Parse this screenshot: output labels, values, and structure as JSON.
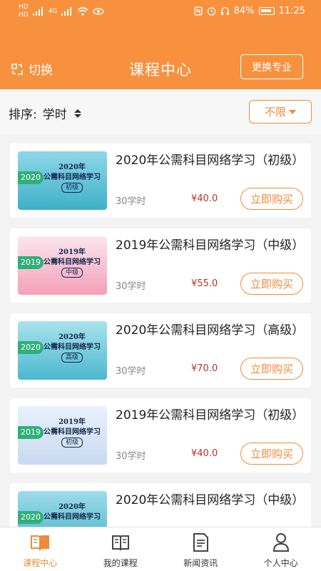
{
  "status_bar": {
    "left_labels": [
      "HD",
      "4G",
      "HD",
      "4G"
    ],
    "battery": "84%",
    "time": "11:25"
  },
  "header": {
    "switch_label": "切换",
    "title": "课程中心",
    "change_major_label": "更换专业"
  },
  "sort": {
    "label": "排序:",
    "value": "学时",
    "filter_label": "不限"
  },
  "courses": [
    {
      "title": "2020年公需科目网络学习（初级）",
      "hours": "30学时",
      "price": "¥40.0",
      "buy_label": "立即购买",
      "thumb": {
        "year": "2020",
        "line1": "2020年",
        "line2": "公需科目网络学习",
        "level": "初级",
        "bg1": "#8ed7e8",
        "bg2": "#3fb0c8"
      }
    },
    {
      "title": "2019年公需科目网络学习（中级）",
      "hours": "30学时",
      "price": "¥55.0",
      "buy_label": "立即购买",
      "thumb": {
        "year": "2019",
        "line1": "2019年",
        "line2": "公需科目网络学习",
        "level": "中级",
        "bg1": "#fbe6ef",
        "bg2": "#f3a0b8"
      }
    },
    {
      "title": "2020年公需科目网络学习（高级）",
      "hours": "30学时",
      "price": "¥70.0",
      "buy_label": "立即购买",
      "thumb": {
        "year": "2020",
        "line1": "2020年",
        "line2": "公需科目网络学习",
        "level": "高级",
        "bg1": "#a9e3ee",
        "bg2": "#4cb8cf"
      }
    },
    {
      "title": "2019年公需科目网络学习（初级）",
      "hours": "30学时",
      "price": "¥40.0",
      "buy_label": "立即购买",
      "thumb": {
        "year": "2019",
        "line1": "2019年",
        "line2": "公需科目网络学习",
        "level": "初级",
        "bg1": "#e9f1fb",
        "bg2": "#c9d9ef"
      }
    },
    {
      "title": "2020年公需科目网络学习（中级）",
      "hours": "",
      "price": "",
      "buy_label": "",
      "thumb": {
        "year": "2020",
        "line1": "2020年",
        "line2": "公需科目网络学习",
        "level": "",
        "bg1": "#9edcea",
        "bg2": "#48b4cb"
      }
    }
  ],
  "tabbar": [
    {
      "label": "课程中心",
      "icon": "open-book-icon",
      "active": true
    },
    {
      "label": "我的课程",
      "icon": "books-icon",
      "active": false
    },
    {
      "label": "新闻资讯",
      "icon": "document-icon",
      "active": false
    },
    {
      "label": "个人中心",
      "icon": "person-icon",
      "active": false
    }
  ],
  "colors": {
    "brand": "#f7913e",
    "accent": "#f08a3a",
    "price": "#c0302c",
    "year_badge": "#2fb07a"
  }
}
